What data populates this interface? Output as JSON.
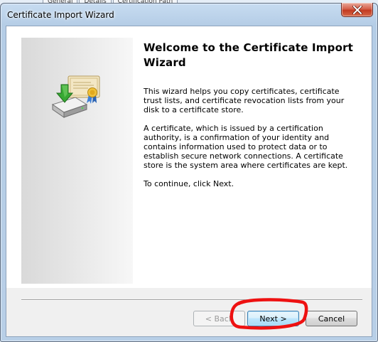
{
  "background_tabs": [
    "General",
    "Details",
    "Certification Path"
  ],
  "window": {
    "title": "Certificate Import Wizard"
  },
  "wizard": {
    "heading": "Welcome to the Certificate Import Wizard",
    "paragraphs": [
      "This wizard helps you copy certificates, certificate trust lists, and certificate revocation lists from your disk to a certificate store.",
      "A certificate, which is issued by a certification authority, is a confirmation of your identity and contains information used to protect data or to establish secure network connections. A certificate store is the system area where certificates are kept.",
      "To continue, click Next."
    ]
  },
  "buttons": {
    "back": "< Back",
    "next": "Next >",
    "cancel": "Cancel"
  },
  "icons": {
    "close": "close-icon",
    "wizard": "certificate-import-icon"
  },
  "colors": {
    "annotation": "#ee1111",
    "default_button_border": "#3c7fb1"
  }
}
